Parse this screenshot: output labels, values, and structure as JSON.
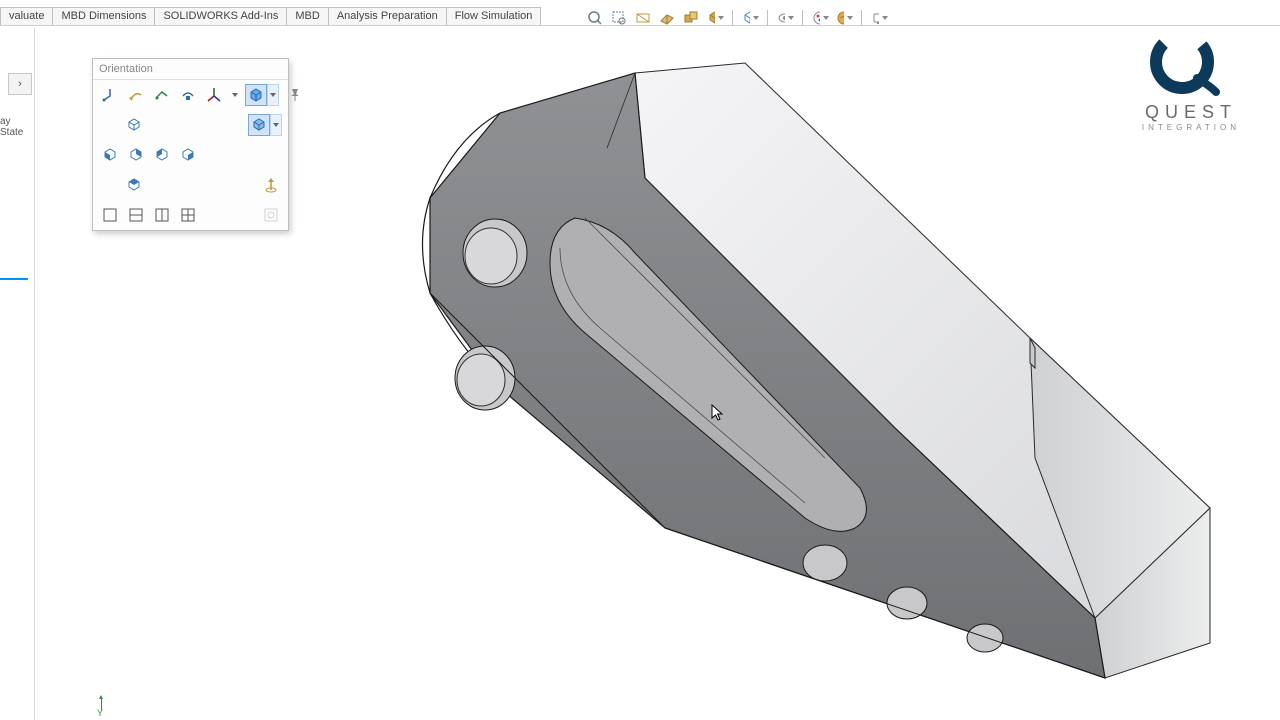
{
  "ribbon": {
    "tabs": [
      "valuate",
      "MBD Dimensions",
      "SOLIDWORKS Add-Ins",
      "MBD",
      "Analysis Preparation",
      "Flow Simulation"
    ]
  },
  "sidebar": {
    "expand_glyph": "›",
    "clipped_label": "ay State"
  },
  "orientation_panel": {
    "title": "Orientation",
    "row1_icons": [
      "view-orientation",
      "previous-view",
      "next-view",
      "view-selector",
      "update-axes",
      "axes-dropdown",
      "view-cube",
      "pushpin"
    ],
    "row2_icons": [
      "dimetric-view"
    ],
    "row2b_icons": [
      "view-cube-mode"
    ],
    "row3_icons": [
      "front-view",
      "back-view",
      "left-view",
      "right-view"
    ],
    "row4_icons": [
      "top-view"
    ],
    "row4_right": [
      "normal-to"
    ],
    "row5_icons": [
      "single-view",
      "two-view-h",
      "two-view-v",
      "four-view"
    ],
    "row5_right": [
      "link-views"
    ]
  },
  "heads_up_toolbar": {
    "icons": [
      "zoom-to-fit",
      "zoom-to-area",
      "previous-view",
      "section-view",
      "view-orientation",
      "display-style",
      "hide-show",
      "edit-appearance",
      "apply-scene",
      "view-settings"
    ]
  },
  "logo": {
    "brand": "QUEST",
    "sub": "INTEGRATION"
  },
  "triad": {
    "y": "Y"
  }
}
